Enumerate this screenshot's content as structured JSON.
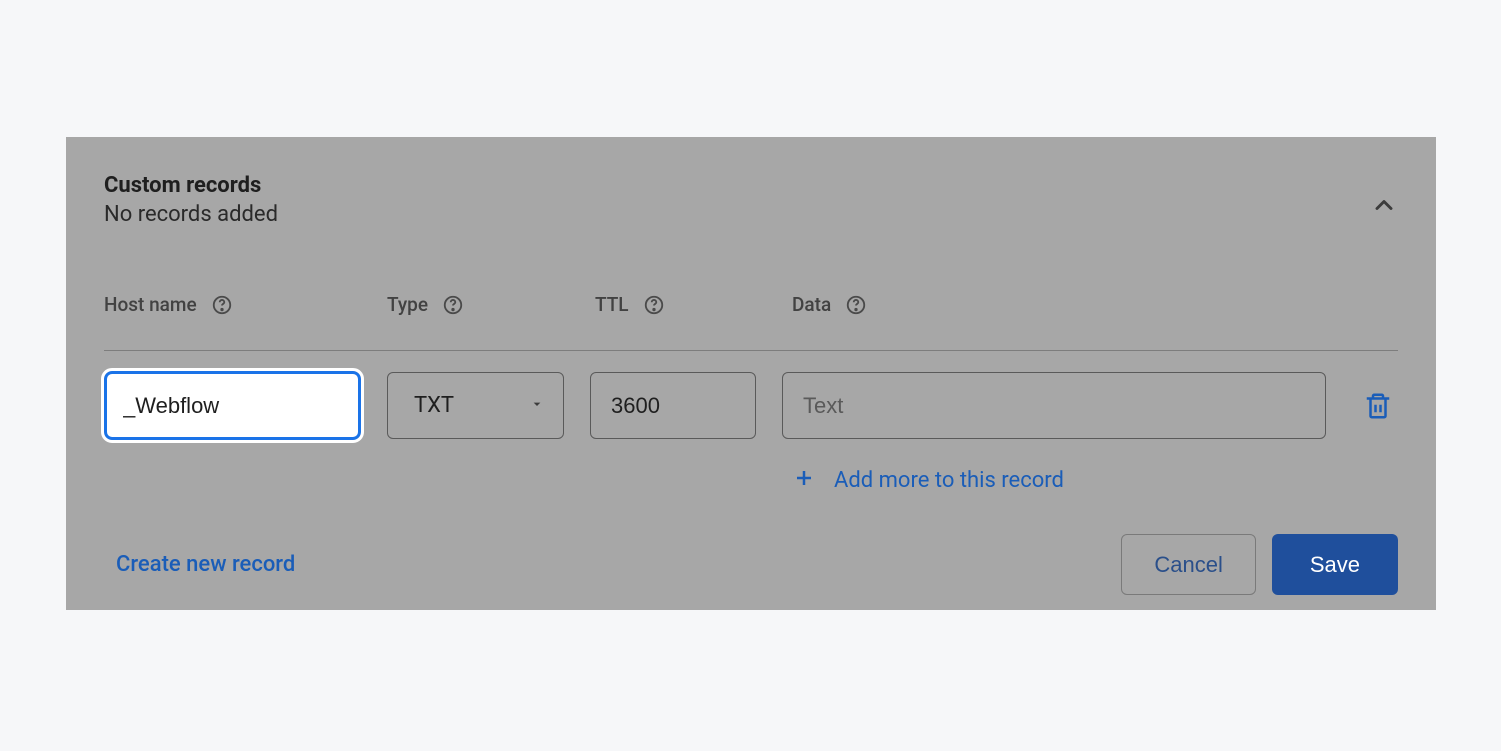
{
  "panel": {
    "title": "Custom records",
    "subtitle": "No records added"
  },
  "columns": {
    "hostname": "Host name",
    "type": "Type",
    "ttl": "TTL",
    "data": "Data"
  },
  "record": {
    "hostname_value": "_Webflow",
    "type_value": "TXT",
    "ttl_value": "3600",
    "data_placeholder": "Text"
  },
  "actions": {
    "add_more": "Add more to this record",
    "create_new": "Create new record",
    "cancel": "Cancel",
    "save": "Save"
  }
}
